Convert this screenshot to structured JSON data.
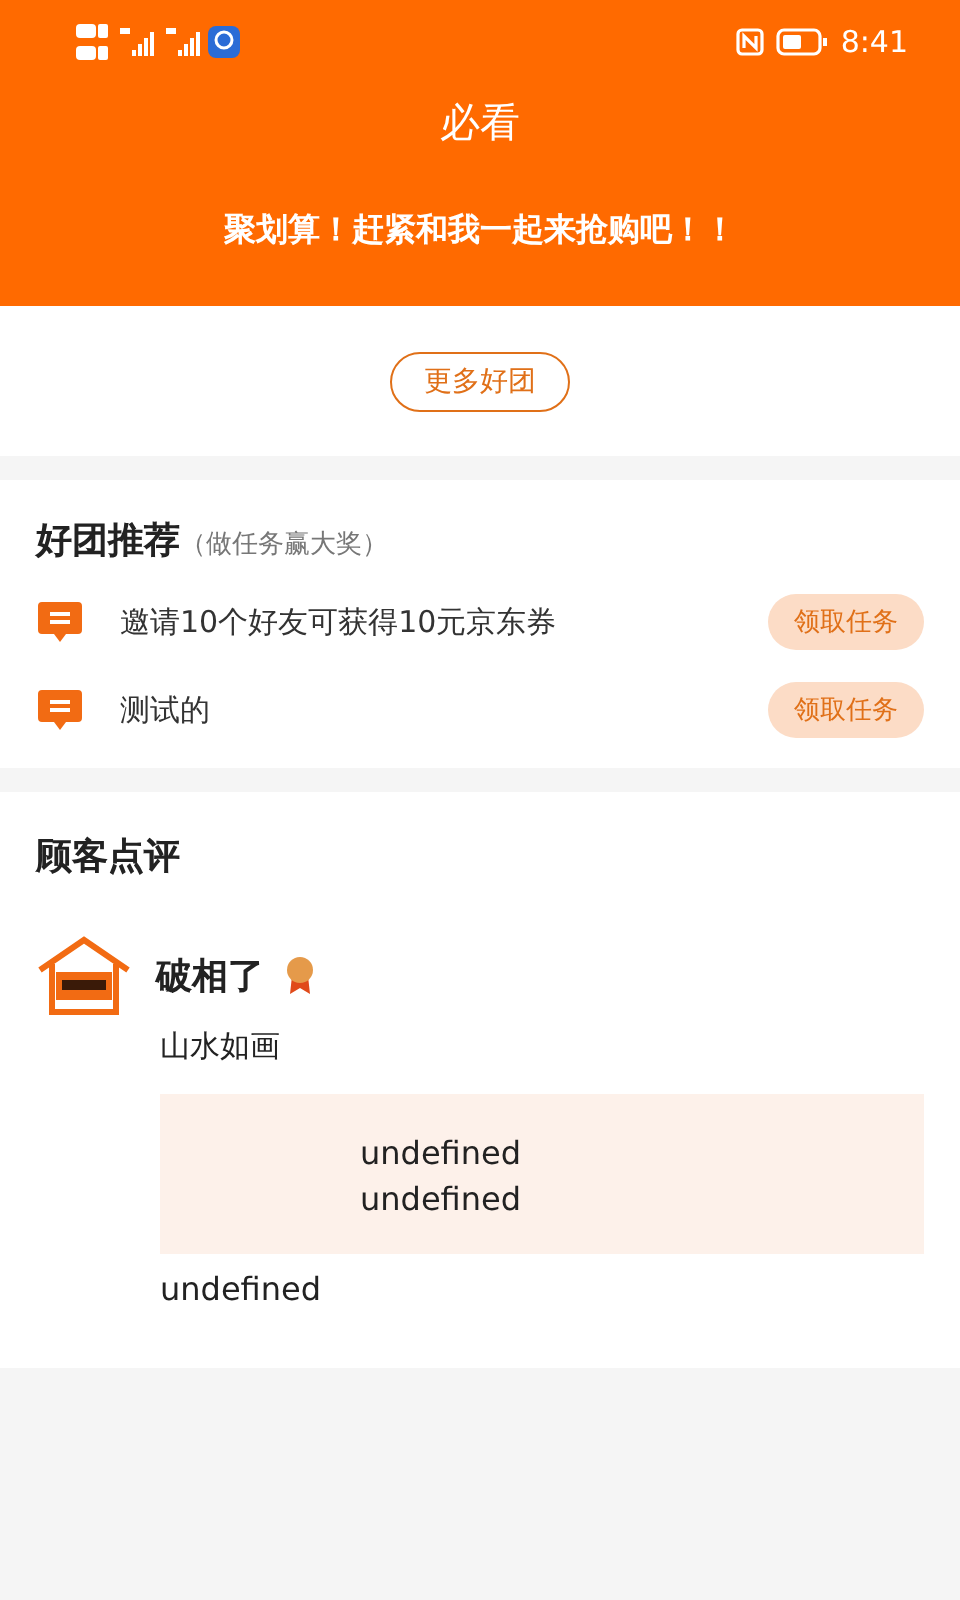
{
  "status_bar": {
    "time": "8:41"
  },
  "header": {
    "title": "必看",
    "subtitle": "聚划算！赶紧和我一起来抢购吧！！"
  },
  "more_button": "更多好团",
  "recommend": {
    "title": "好团推荐",
    "hint": "（做任务赢大奖）",
    "tasks": [
      {
        "text": "邀请10个好友可获得10元京东券",
        "action": "领取任务"
      },
      {
        "text": "测试的",
        "action": "领取任务"
      }
    ]
  },
  "reviews": {
    "title": "顾客点评",
    "items": [
      {
        "name": "破相了",
        "content": "山水如画",
        "quote": [
          "undefined",
          "undefined"
        ],
        "footer": "undefined"
      }
    ]
  }
}
